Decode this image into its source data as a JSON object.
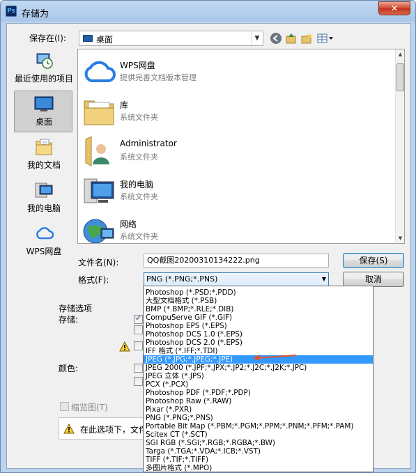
{
  "window": {
    "title": "存储为",
    "app_icon": "Ps",
    "close_label": "✕"
  },
  "toolbar": {
    "save_in_label": "保存在(I):",
    "location": "桌面",
    "icons": [
      "back-icon",
      "up-folder-icon",
      "new-folder-icon",
      "view-menu-icon"
    ]
  },
  "places": [
    {
      "label": "最近使用的项目",
      "icon": "recent-icon"
    },
    {
      "label": "桌面",
      "icon": "desktop-icon"
    },
    {
      "label": "我的文档",
      "icon": "documents-icon"
    },
    {
      "label": "我的电脑",
      "icon": "computer-icon"
    },
    {
      "label": "WPS网盘",
      "icon": "wps-cloud-icon"
    }
  ],
  "files": [
    {
      "name": "WPS网盘",
      "desc": "提供完善文档版本管理",
      "icon": "wps-cloud-icon"
    },
    {
      "name": "库",
      "desc": "系统文件夹",
      "icon": "library-icon"
    },
    {
      "name": "Administrator",
      "desc": "系统文件夹",
      "icon": "user-folder-icon"
    },
    {
      "name": "我的电脑",
      "desc": "系统文件夹",
      "icon": "computer-icon"
    },
    {
      "name": "网络",
      "desc": "系统文件夹",
      "icon": "network-icon"
    }
  ],
  "form": {
    "filename_label": "文件名(N):",
    "filename_value": "QQ截图20200310134222.png",
    "format_label": "格式(F):",
    "format_value": "PNG (*.PNG;*.PNS)",
    "save_button": "保存(S)",
    "cancel_button": "取消"
  },
  "options": {
    "group_title": "存储选项",
    "store_label": "存储:",
    "color_label": "颜色:",
    "thumbnail_label": "缩览图(T)",
    "warning_text": "在此选项下，文件"
  },
  "format_options": [
    "Photoshop (*.PSD;*.PDD)",
    "大型文档格式 (*.PSB)",
    "BMP (*.BMP;*.RLE;*.DIB)",
    "CompuServe GIF (*.GIF)",
    "Photoshop EPS (*.EPS)",
    "Photoshop DCS 1.0 (*.EPS)",
    "Photoshop DCS 2.0 (*.EPS)",
    "IFF 格式 (*.IFF;*.TDI)",
    "JPEG (*.JPG;*.JPEG;*.JPE)",
    "JPEG 2000 (*.JPF;*.JPX;*.JP2;*.J2C;*.J2K;*.JPC)",
    "JPEG 立体 (*.JPS)",
    "PCX (*.PCX)",
    "Photoshop PDF (*.PDF;*.PDP)",
    "Photoshop Raw (*.RAW)",
    "Pixar (*.PXR)",
    "PNG (*.PNG;*.PNS)",
    "Portable Bit Map (*.PBM;*.PGM;*.PPM;*.PNM;*.PFM;*.PAM)",
    "Scitex CT (*.SCT)",
    "SGI RGB (*.SGI;*.RGB;*.RGBA;*.BW)",
    "Targa (*.TGA;*.VDA;*.ICB;*.VST)",
    "TIFF (*.TIF;*.TIFF)",
    "多图片格式 (*.MPO)"
  ],
  "selected_format_index": 8,
  "colors": {
    "accent": "#3399ff",
    "annotation": "#e8502a"
  }
}
